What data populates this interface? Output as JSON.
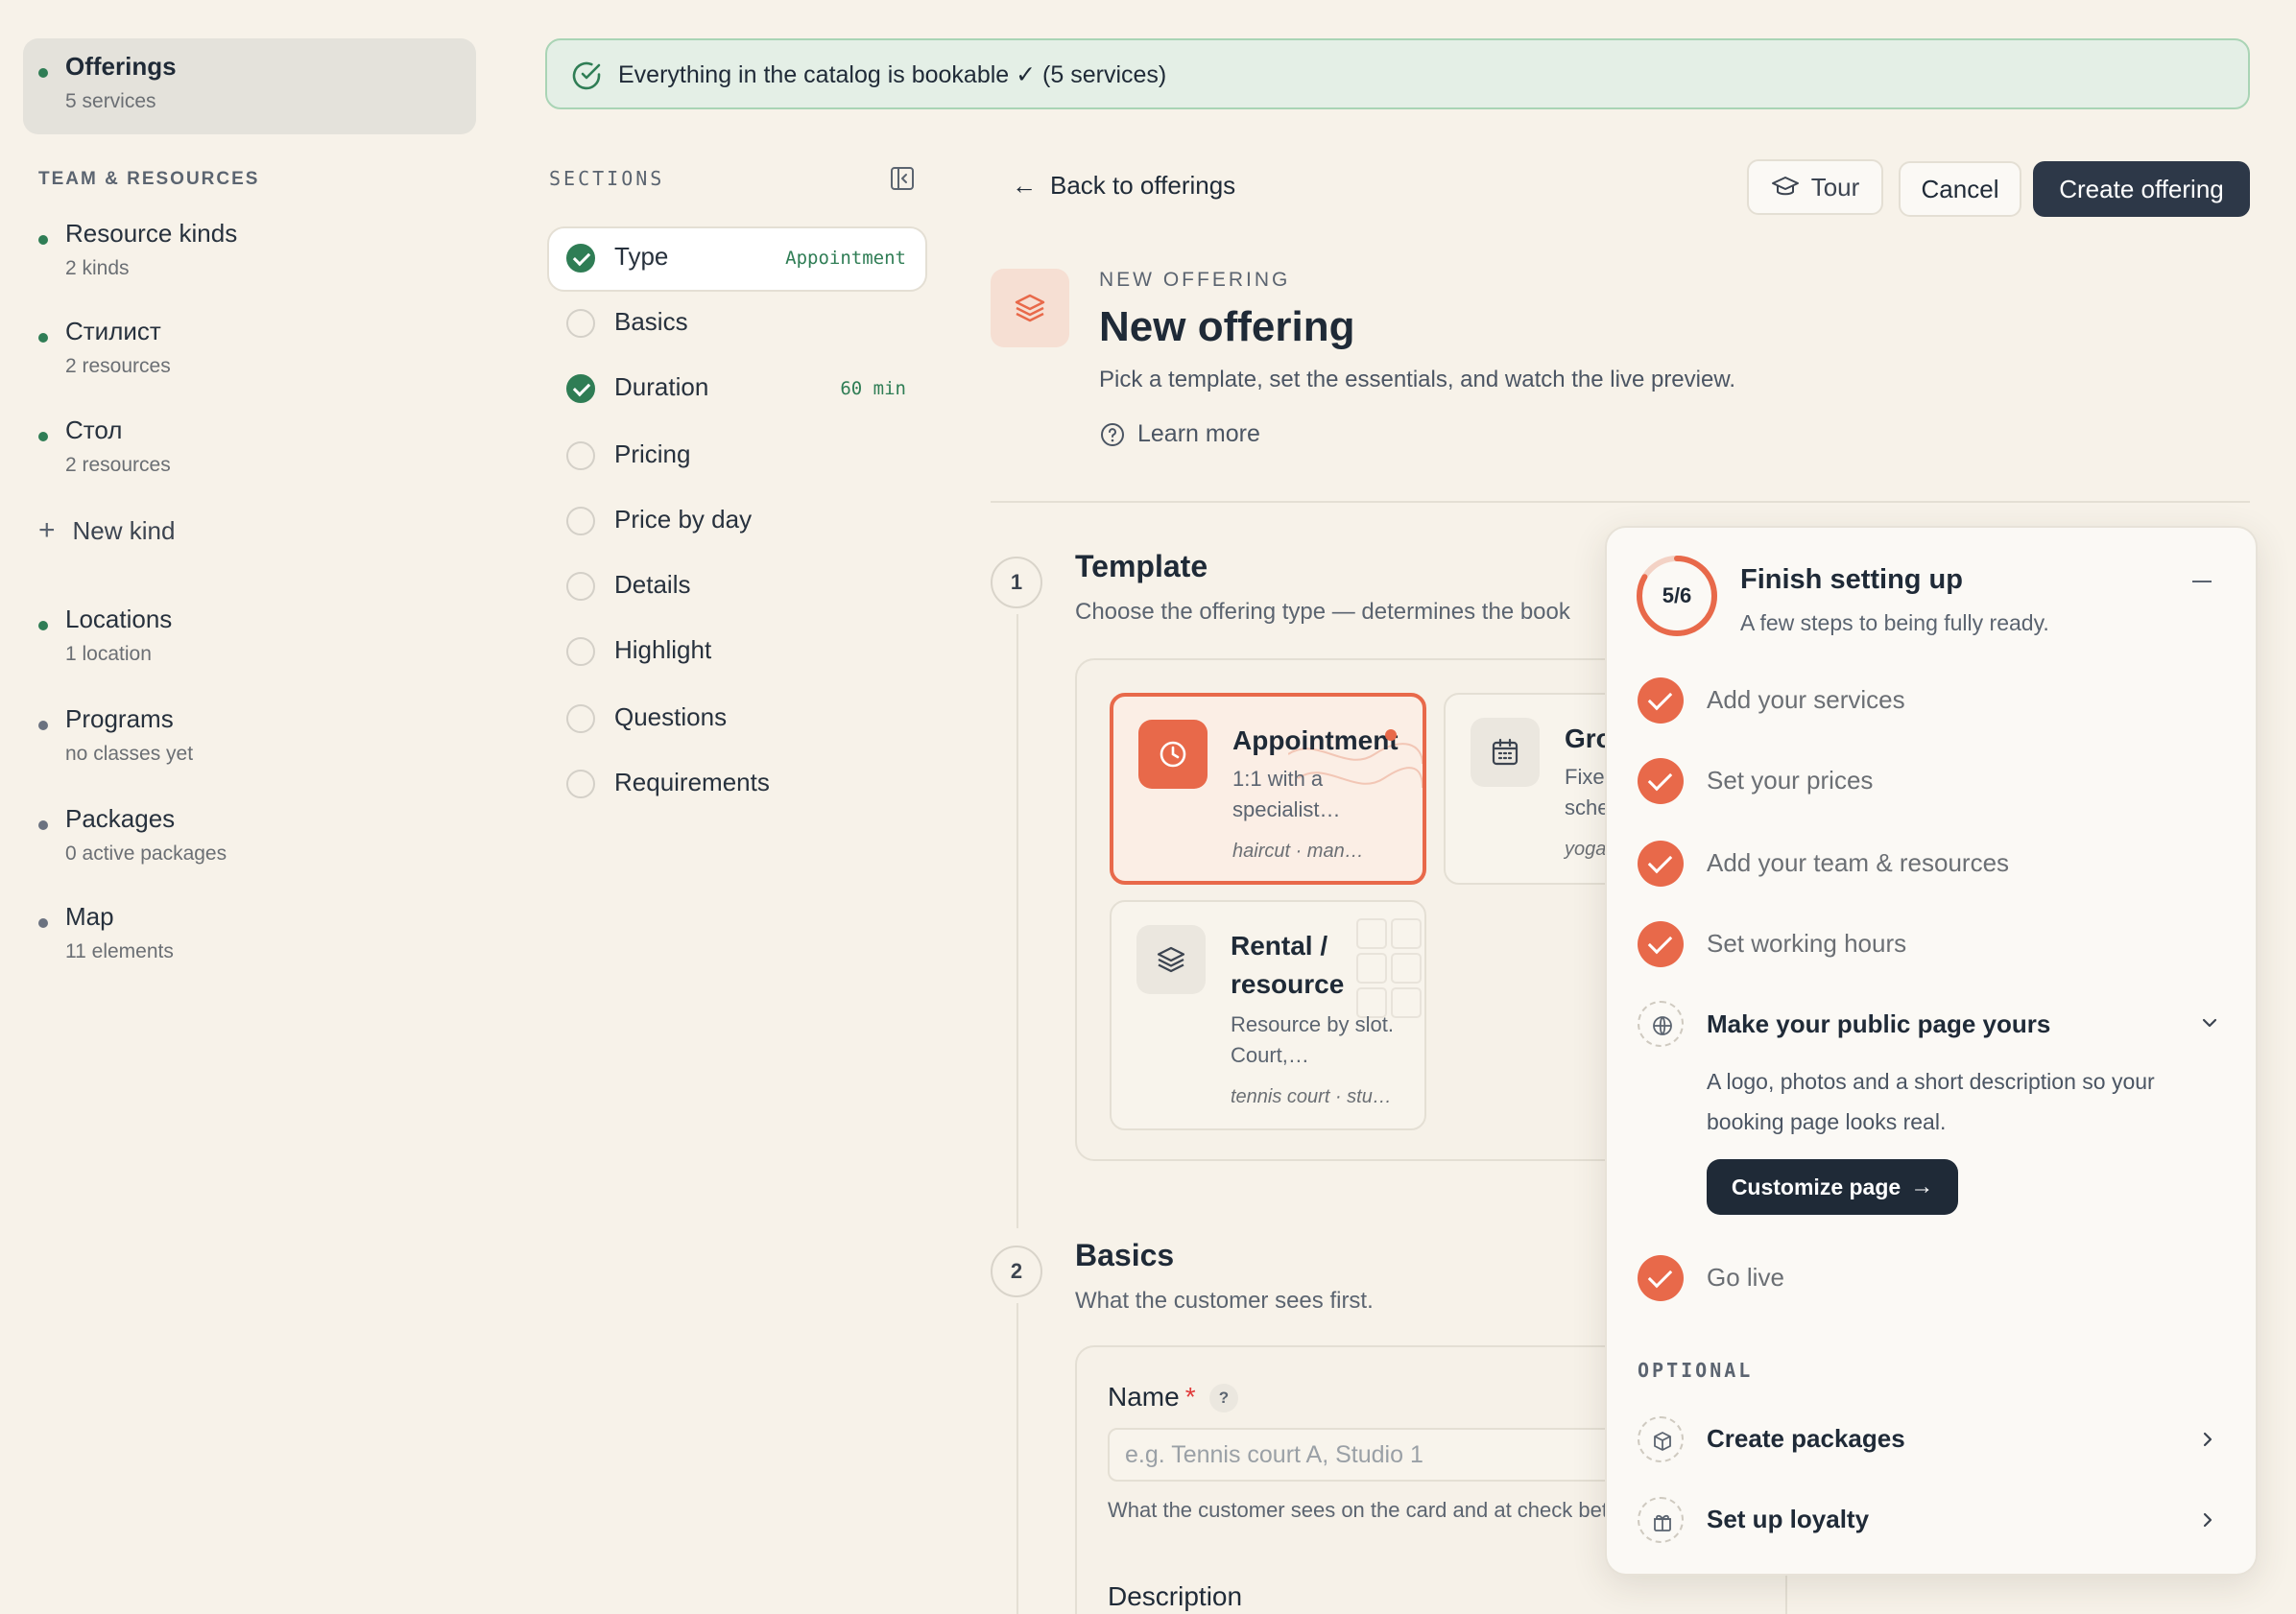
{
  "sidebar": {
    "offerings": {
      "label": "Offerings",
      "sub": "5 services"
    },
    "team_label": "TEAM & RESOURCES",
    "items": [
      {
        "label": "Resource kinds",
        "sub": "2 kinds"
      },
      {
        "label": "Стилист",
        "sub": "2 resources"
      },
      {
        "label": "Стол",
        "sub": "2 resources"
      }
    ],
    "new_kind": "New kind",
    "more": [
      {
        "label": "Locations",
        "sub": "1 location"
      },
      {
        "label": "Programs",
        "sub": "no classes yet"
      },
      {
        "label": "Packages",
        "sub": "0 active packages"
      },
      {
        "label": "Map",
        "sub": "11 elements"
      }
    ]
  },
  "banner": {
    "text": "Everything in the catalog is bookable ✓ (5 services)"
  },
  "sections": {
    "label": "SECTIONS",
    "items": [
      {
        "label": "Type",
        "tag": "Appointment",
        "done": true
      },
      {
        "label": "Basics",
        "tag": "",
        "done": false
      },
      {
        "label": "Duration",
        "tag": "60 min",
        "done": true
      },
      {
        "label": "Pricing",
        "tag": "",
        "done": false
      },
      {
        "label": "Price by day",
        "tag": "",
        "done": false
      },
      {
        "label": "Details",
        "tag": "",
        "done": false
      },
      {
        "label": "Highlight",
        "tag": "",
        "done": false
      },
      {
        "label": "Questions",
        "tag": "",
        "done": false
      },
      {
        "label": "Requirements",
        "tag": "",
        "done": false
      }
    ]
  },
  "header": {
    "back": "Back to offerings",
    "tour": "Tour",
    "cancel": "Cancel",
    "create": "Create offering",
    "eyebrow": "NEW OFFERING",
    "title": "New offering",
    "subtitle": "Pick a template, set the essentials, and watch the live preview.",
    "learn_more": "Learn more"
  },
  "steps": {
    "template": {
      "num": "1",
      "title": "Template",
      "sub": "Choose the offering type — determines the book",
      "cards": [
        {
          "title": "Appointment",
          "desc": "1:1 with a specialist…",
          "examples": "haircut · man…",
          "selected": true
        },
        {
          "title": "Gro",
          "desc": "Fixe sche",
          "examples": "yoga",
          "selected": false
        },
        {
          "title": "Rental / resource",
          "desc": "Resource by slot. Court,…",
          "examples": "tennis court · stu…",
          "selected": false
        }
      ]
    },
    "basics": {
      "num": "2",
      "title": "Basics",
      "sub": "What the customer sees first.",
      "name_label": "Name",
      "name_required": "*",
      "help_badge": "?",
      "name_placeholder": "e.g. Tennis court A, Studio 1",
      "name_help": "What the customer sees on the card and at check better.",
      "description_label": "Description"
    }
  },
  "setup": {
    "progress": "5/6",
    "progress_fraction": 0.8333,
    "title": "Finish setting up",
    "sub": "A few steps to being fully ready.",
    "tasks": [
      {
        "label": "Add your services",
        "done": true
      },
      {
        "label": "Set your prices",
        "done": true
      },
      {
        "label": "Add your team & resources",
        "done": true
      },
      {
        "label": "Set working hours",
        "done": true
      }
    ],
    "expanded": {
      "label": "Make your public page yours",
      "desc": "A logo, photos and a short description so your booking page looks real.",
      "button": "Customize page"
    },
    "go_live": "Go live",
    "optional_label": "OPTIONAL",
    "optional": [
      {
        "label": "Create packages"
      },
      {
        "label": "Set up loyalty"
      }
    ]
  },
  "colors": {
    "accent": "#e8694a",
    "success": "#2f7d55",
    "dark": "#2d3848",
    "background": "#f7f2e9"
  }
}
